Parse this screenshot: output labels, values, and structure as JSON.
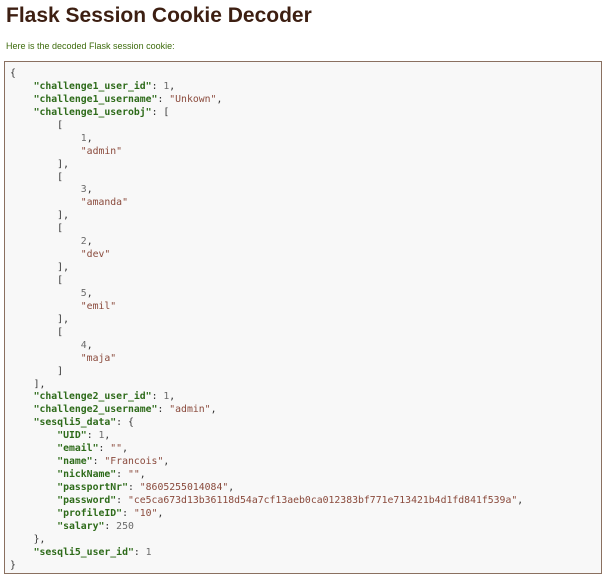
{
  "page": {
    "title": "Flask Session Cookie Decoder",
    "intro": "Here is the decoded Flask session cookie:"
  },
  "colors": {
    "title": "#3d1f12",
    "intro": "#3d6b0c",
    "key": "#2e6b1a",
    "string": "#8a4a3c",
    "number": "#6b6b6b",
    "code_background": "#f8f8f8",
    "code_border": "#8a7060"
  },
  "code": {
    "lines": [
      [
        {
          "t": "p",
          "v": "{"
        }
      ],
      [
        {
          "t": "p",
          "v": "    "
        },
        {
          "t": "k",
          "v": "\"challenge1_user_id\""
        },
        {
          "t": "p",
          "v": ": "
        },
        {
          "t": "n",
          "v": "1"
        },
        {
          "t": "p",
          "v": ","
        }
      ],
      [
        {
          "t": "p",
          "v": "    "
        },
        {
          "t": "k",
          "v": "\"challenge1_username\""
        },
        {
          "t": "p",
          "v": ": "
        },
        {
          "t": "s",
          "v": "\"Unkown\""
        },
        {
          "t": "p",
          "v": ","
        }
      ],
      [
        {
          "t": "p",
          "v": "    "
        },
        {
          "t": "k",
          "v": "\"challenge1_userobj\""
        },
        {
          "t": "p",
          "v": ": ["
        }
      ],
      [
        {
          "t": "p",
          "v": "        ["
        }
      ],
      [
        {
          "t": "p",
          "v": "            "
        },
        {
          "t": "n",
          "v": "1"
        },
        {
          "t": "p",
          "v": ","
        }
      ],
      [
        {
          "t": "p",
          "v": "            "
        },
        {
          "t": "s",
          "v": "\"admin\""
        }
      ],
      [
        {
          "t": "p",
          "v": "        ],"
        }
      ],
      [
        {
          "t": "p",
          "v": "        ["
        }
      ],
      [
        {
          "t": "p",
          "v": "            "
        },
        {
          "t": "n",
          "v": "3"
        },
        {
          "t": "p",
          "v": ","
        }
      ],
      [
        {
          "t": "p",
          "v": "            "
        },
        {
          "t": "s",
          "v": "\"amanda\""
        }
      ],
      [
        {
          "t": "p",
          "v": "        ],"
        }
      ],
      [
        {
          "t": "p",
          "v": "        ["
        }
      ],
      [
        {
          "t": "p",
          "v": "            "
        },
        {
          "t": "n",
          "v": "2"
        },
        {
          "t": "p",
          "v": ","
        }
      ],
      [
        {
          "t": "p",
          "v": "            "
        },
        {
          "t": "s",
          "v": "\"dev\""
        }
      ],
      [
        {
          "t": "p",
          "v": "        ],"
        }
      ],
      [
        {
          "t": "p",
          "v": "        ["
        }
      ],
      [
        {
          "t": "p",
          "v": "            "
        },
        {
          "t": "n",
          "v": "5"
        },
        {
          "t": "p",
          "v": ","
        }
      ],
      [
        {
          "t": "p",
          "v": "            "
        },
        {
          "t": "s",
          "v": "\"emil\""
        }
      ],
      [
        {
          "t": "p",
          "v": "        ],"
        }
      ],
      [
        {
          "t": "p",
          "v": "        ["
        }
      ],
      [
        {
          "t": "p",
          "v": "            "
        },
        {
          "t": "n",
          "v": "4"
        },
        {
          "t": "p",
          "v": ","
        }
      ],
      [
        {
          "t": "p",
          "v": "            "
        },
        {
          "t": "s",
          "v": "\"maja\""
        }
      ],
      [
        {
          "t": "p",
          "v": "        ]"
        }
      ],
      [
        {
          "t": "p",
          "v": "    ],"
        }
      ],
      [
        {
          "t": "p",
          "v": "    "
        },
        {
          "t": "k",
          "v": "\"challenge2_user_id\""
        },
        {
          "t": "p",
          "v": ": "
        },
        {
          "t": "n",
          "v": "1"
        },
        {
          "t": "p",
          "v": ","
        }
      ],
      [
        {
          "t": "p",
          "v": "    "
        },
        {
          "t": "k",
          "v": "\"challenge2_username\""
        },
        {
          "t": "p",
          "v": ": "
        },
        {
          "t": "s",
          "v": "\"admin\""
        },
        {
          "t": "p",
          "v": ","
        }
      ],
      [
        {
          "t": "p",
          "v": "    "
        },
        {
          "t": "k",
          "v": "\"sesqli5_data\""
        },
        {
          "t": "p",
          "v": ": {"
        }
      ],
      [
        {
          "t": "p",
          "v": "        "
        },
        {
          "t": "k",
          "v": "\"UID\""
        },
        {
          "t": "p",
          "v": ": "
        },
        {
          "t": "n",
          "v": "1"
        },
        {
          "t": "p",
          "v": ","
        }
      ],
      [
        {
          "t": "p",
          "v": "        "
        },
        {
          "t": "k",
          "v": "\"email\""
        },
        {
          "t": "p",
          "v": ": "
        },
        {
          "t": "s",
          "v": "\"\""
        },
        {
          "t": "p",
          "v": ","
        }
      ],
      [
        {
          "t": "p",
          "v": "        "
        },
        {
          "t": "k",
          "v": "\"name\""
        },
        {
          "t": "p",
          "v": ": "
        },
        {
          "t": "s",
          "v": "\"Francois\""
        },
        {
          "t": "p",
          "v": ","
        }
      ],
      [
        {
          "t": "p",
          "v": "        "
        },
        {
          "t": "k",
          "v": "\"nickName\""
        },
        {
          "t": "p",
          "v": ": "
        },
        {
          "t": "s",
          "v": "\"\""
        },
        {
          "t": "p",
          "v": ","
        }
      ],
      [
        {
          "t": "p",
          "v": "        "
        },
        {
          "t": "k",
          "v": "\"passportNr\""
        },
        {
          "t": "p",
          "v": ": "
        },
        {
          "t": "s",
          "v": "\"8605255014084\""
        },
        {
          "t": "p",
          "v": ","
        }
      ],
      [
        {
          "t": "p",
          "v": "        "
        },
        {
          "t": "k",
          "v": "\"password\""
        },
        {
          "t": "p",
          "v": ": "
        },
        {
          "t": "s",
          "v": "\"ce5ca673d13b36118d54a7cf13aeb0ca012383bf771e713421b4d1fd841f539a\""
        },
        {
          "t": "p",
          "v": ","
        }
      ],
      [
        {
          "t": "p",
          "v": "        "
        },
        {
          "t": "k",
          "v": "\"profileID\""
        },
        {
          "t": "p",
          "v": ": "
        },
        {
          "t": "s",
          "v": "\"10\""
        },
        {
          "t": "p",
          "v": ","
        }
      ],
      [
        {
          "t": "p",
          "v": "        "
        },
        {
          "t": "k",
          "v": "\"salary\""
        },
        {
          "t": "p",
          "v": ": "
        },
        {
          "t": "n",
          "v": "250"
        }
      ],
      [
        {
          "t": "p",
          "v": "    },"
        }
      ],
      [
        {
          "t": "p",
          "v": "    "
        },
        {
          "t": "k",
          "v": "\"sesqli5_user_id\""
        },
        {
          "t": "p",
          "v": ": "
        },
        {
          "t": "n",
          "v": "1"
        }
      ],
      [
        {
          "t": "p",
          "v": "}"
        }
      ]
    ]
  }
}
